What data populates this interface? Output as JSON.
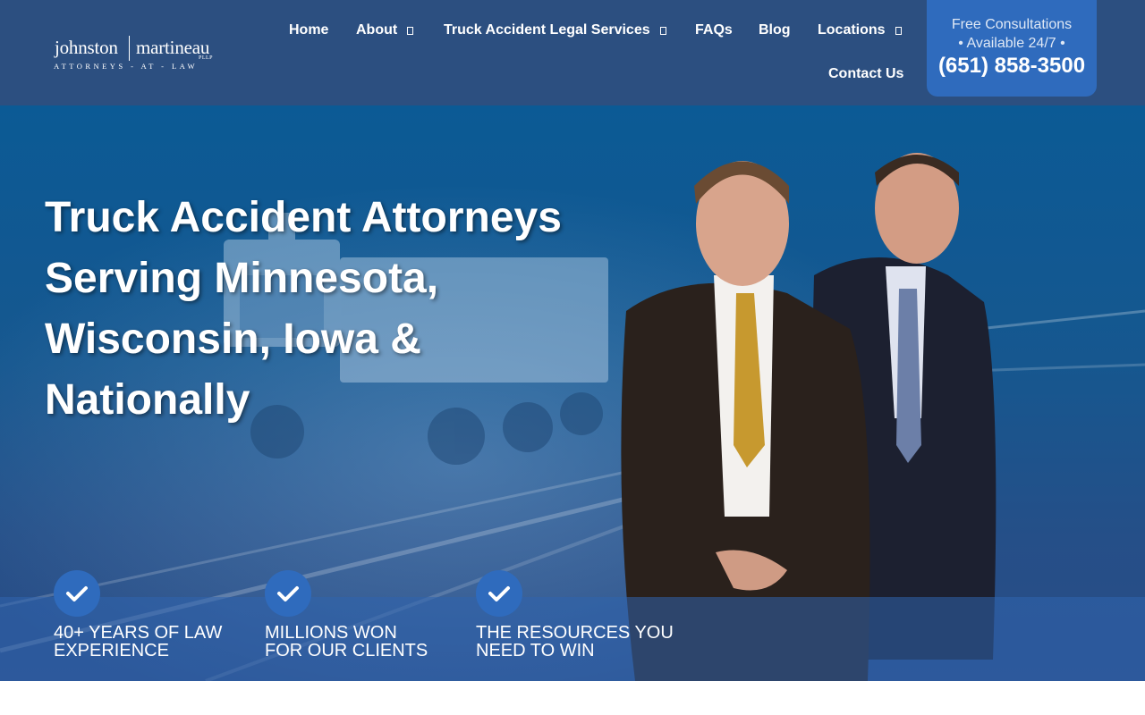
{
  "header": {
    "logo": {
      "name_left": "johnston",
      "name_right": "martineau",
      "suffix": "PLLP",
      "tagline": "ATTORNEYS - AT - LAW"
    },
    "nav": {
      "items": [
        {
          "label": "Home",
          "has_dropdown": false
        },
        {
          "label": "About",
          "has_dropdown": true
        },
        {
          "label": "Truck Accident Legal Services",
          "has_dropdown": true
        },
        {
          "label": "FAQs",
          "has_dropdown": false
        },
        {
          "label": "Blog",
          "has_dropdown": false
        },
        {
          "label": "Locations",
          "has_dropdown": true
        },
        {
          "label": "Contact Us",
          "has_dropdown": false
        }
      ]
    },
    "cta": {
      "line1": "Free Consultations",
      "line2": "• Available 24/7 •",
      "phone": "(651) 858-3500"
    }
  },
  "hero": {
    "headline_lines": [
      "Truck Accident Attorneys",
      "Serving Minnesota,",
      "Wisconsin, Iowa &",
      "Nationally"
    ],
    "features": [
      {
        "icon": "check-icon",
        "line1": "40+ YEARS OF LAW",
        "line2": "EXPERIENCE"
      },
      {
        "icon": "check-icon",
        "line1": "MILLIONS WON",
        "line2": "FOR OUR CLIENTS"
      },
      {
        "icon": "check-icon",
        "line1": "THE RESOURCES YOU",
        "line2": "NEED TO WIN"
      }
    ]
  },
  "colors": {
    "header_bg": "#2c4f80",
    "cta_bg": "#2f6bbd",
    "check_bg": "#2f6bbd",
    "text": "#ffffff"
  }
}
